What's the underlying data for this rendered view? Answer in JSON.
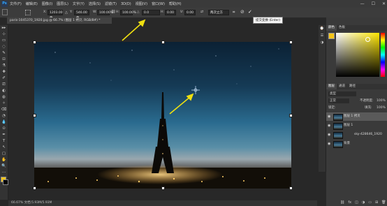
{
  "menu": {
    "logo": "Ps",
    "items": [
      "文件(F)",
      "编辑(E)",
      "图像(I)",
      "图层(L)",
      "文字(Y)",
      "选择(S)",
      "滤镜(T)",
      "3D(D)",
      "视图(V)",
      "窗口(W)",
      "帮助(H)"
    ],
    "window_controls": [
      "—",
      "☐",
      "✕"
    ]
  },
  "options": {
    "x_label": "X:",
    "x_value": "1203.00 像",
    "y_label": "Y:",
    "y_value": "546.00 像",
    "w_label": "W:",
    "w_value": "100.00%",
    "h_label": "H:",
    "h_value": "100.00%",
    "angle_label": "△",
    "angle_value": "0.0",
    "h_skew_label": "H:",
    "h_skew_value": "0.00",
    "v_skew_label": "V:",
    "v_skew_value": "0.00",
    "interp_value": "两次立方",
    "tooltip": "提交变换 (Enter)"
  },
  "document": {
    "tab_label": "paris-1045370_1920.jpg @ 66.7% (图层 1 拷贝, RGB/8#) *",
    "status": "66.67%      文档:5.93M/5.93M"
  },
  "toolbar": {
    "tools": [
      "▸▸",
      "⊹",
      "▭",
      "◌",
      "✎",
      "⊡",
      "⚗",
      "✚",
      "✐",
      "⎚",
      "◐",
      "◍",
      "✧",
      "⌫",
      "◔",
      "💧",
      "⊙",
      "✒",
      "T",
      "↖",
      "▢",
      "✋",
      "🔍",
      "⋯"
    ]
  },
  "color": {
    "tab1": "颜色",
    "tab2": "色板",
    "foreground": "#f5c518",
    "hue_accent": "#ffe600"
  },
  "layers": {
    "tabs": [
      "图层",
      "通道",
      "路径"
    ],
    "kind_label": "类型",
    "blend_mode": "正常",
    "opacity_label": "不透明度:",
    "opacity_value": "100%",
    "lock_label": "锁定:",
    "fill_label": "填充:",
    "fill_value": "100%",
    "rows": [
      {
        "name": "图层 1 拷贝",
        "selected": true
      },
      {
        "name": "图层 1",
        "selected": false
      },
      {
        "name": "sky-428646_1920",
        "selected": false
      },
      {
        "name": "背景",
        "selected": false
      }
    ],
    "bottom_icons": [
      "⛓",
      "fx",
      "◫",
      "◑",
      "▭",
      "⊞",
      "🗑"
    ]
  }
}
